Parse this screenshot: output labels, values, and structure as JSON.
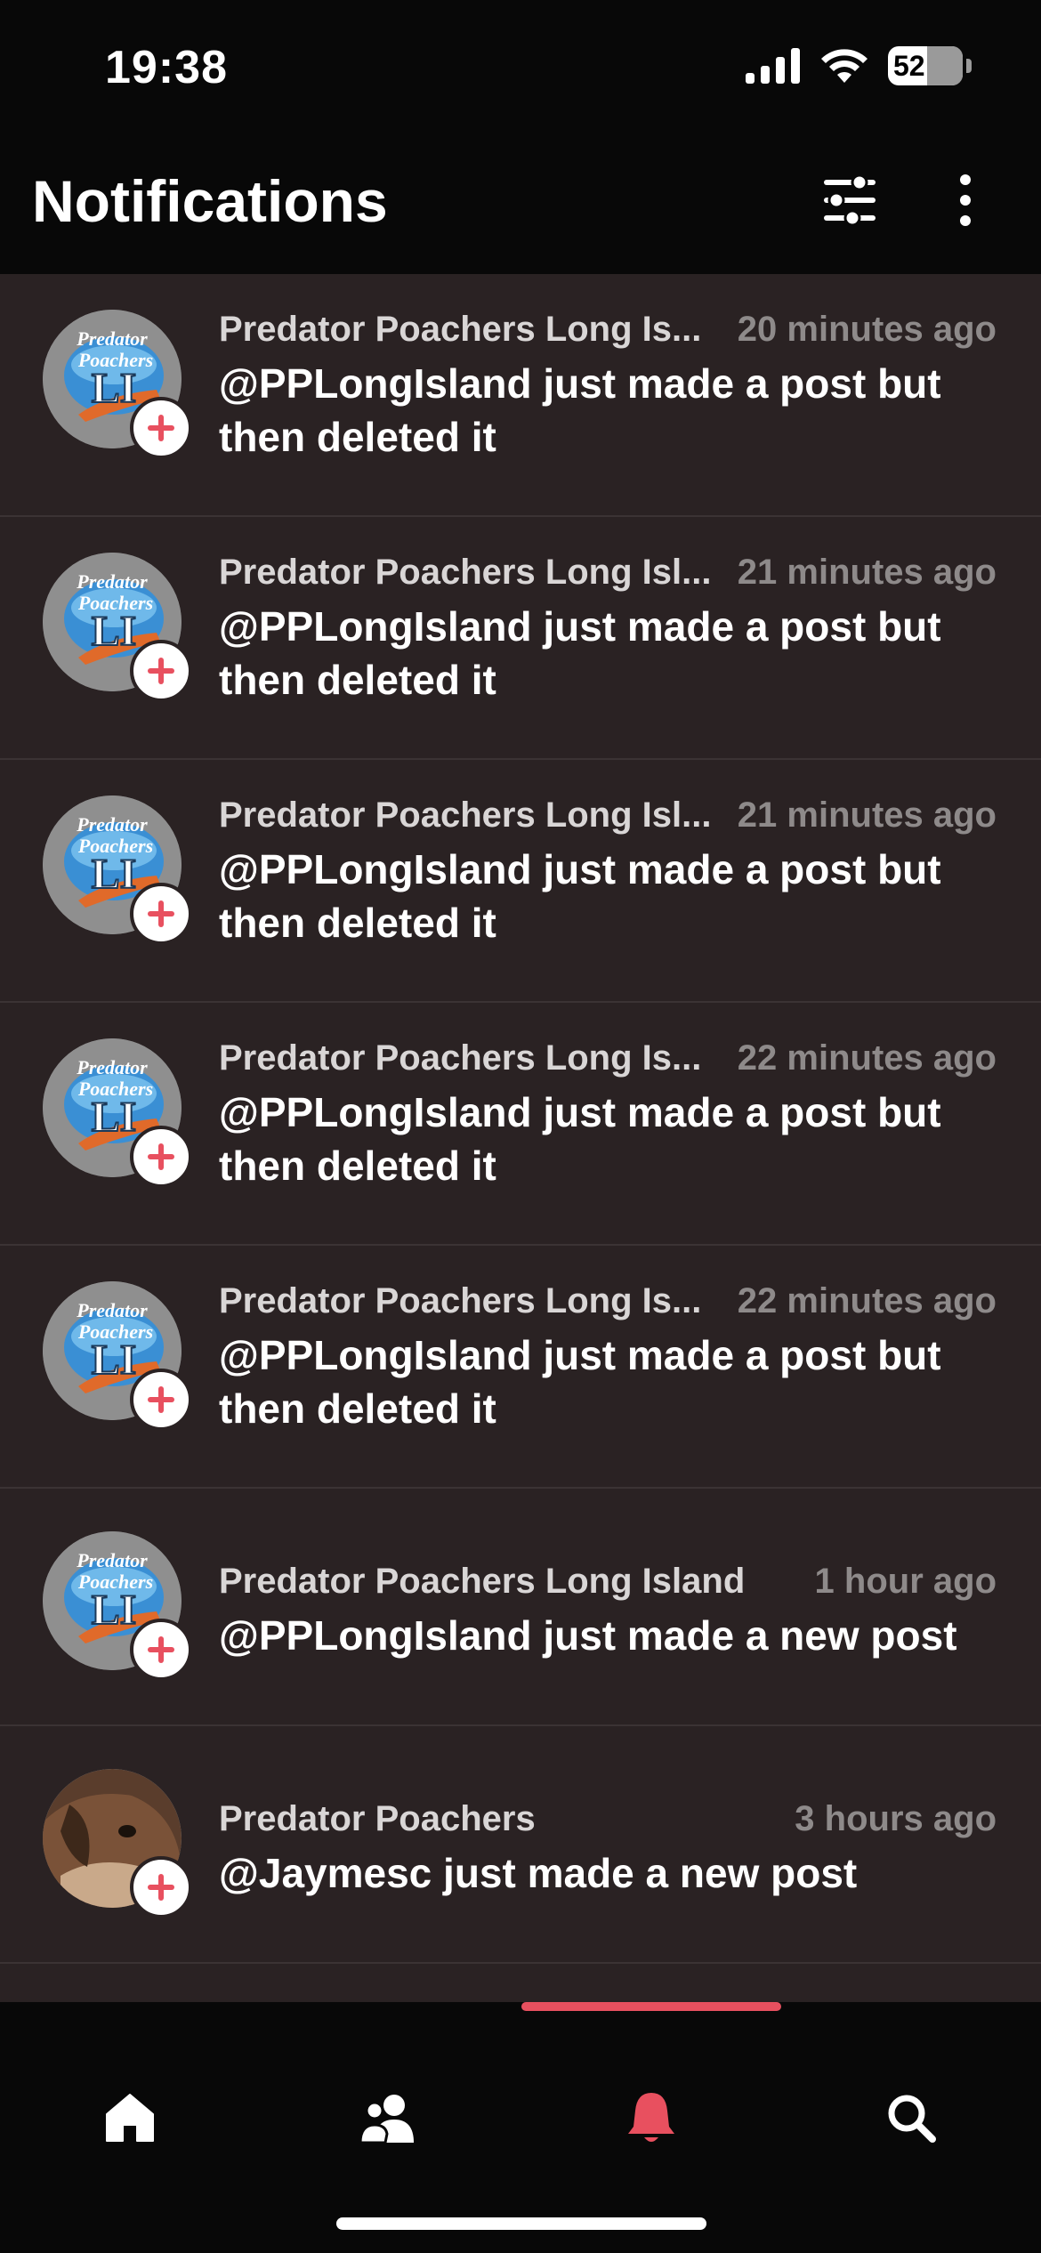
{
  "status_bar": {
    "time": "19:38",
    "battery": "52"
  },
  "header": {
    "title": "Notifications",
    "filter_icon": "sliders-icon",
    "more_icon": "more-vertical-icon"
  },
  "notifications": [
    {
      "sender": "Predator Poachers Long Is...",
      "time": "20 minutes ago",
      "message": "@PPLongIsland just made a post but then deleted it",
      "avatar": "pp-long-island-logo"
    },
    {
      "sender": "Predator Poachers Long Isl...",
      "time": "21 minutes ago",
      "message": "@PPLongIsland just made a post but then deleted it",
      "avatar": "pp-long-island-logo"
    },
    {
      "sender": "Predator Poachers Long Isl...",
      "time": "21 minutes ago",
      "message": "@PPLongIsland just made a post but then deleted it",
      "avatar": "pp-long-island-logo"
    },
    {
      "sender": "Predator Poachers Long Is...",
      "time": "22 minutes ago",
      "message": "@PPLongIsland just made a post but then deleted it",
      "avatar": "pp-long-island-logo"
    },
    {
      "sender": "Predator Poachers Long Is...",
      "time": "22 minutes ago",
      "message": "@PPLongIsland just made a post but then deleted it",
      "avatar": "pp-long-island-logo"
    },
    {
      "sender": "Predator Poachers Long Island",
      "time": "1 hour ago",
      "message": "@PPLongIsland just made a new post",
      "avatar": "pp-long-island-logo"
    },
    {
      "sender": "Predator Poachers",
      "time": "3 hours ago",
      "message": "@Jaymesc just made a new post",
      "avatar": "dog-photo"
    }
  ],
  "logo_text": {
    "line1": "Predator",
    "line2": "Poachers",
    "line3": "LI"
  },
  "bottom_nav": {
    "items": [
      "home-icon",
      "people-icon",
      "bell-icon",
      "search-icon"
    ],
    "active": "bell-icon"
  },
  "colors": {
    "background": "#080808",
    "list_background": "#2a2223",
    "accent": "#e8505f",
    "secondary_text": "#8e8a8a"
  }
}
